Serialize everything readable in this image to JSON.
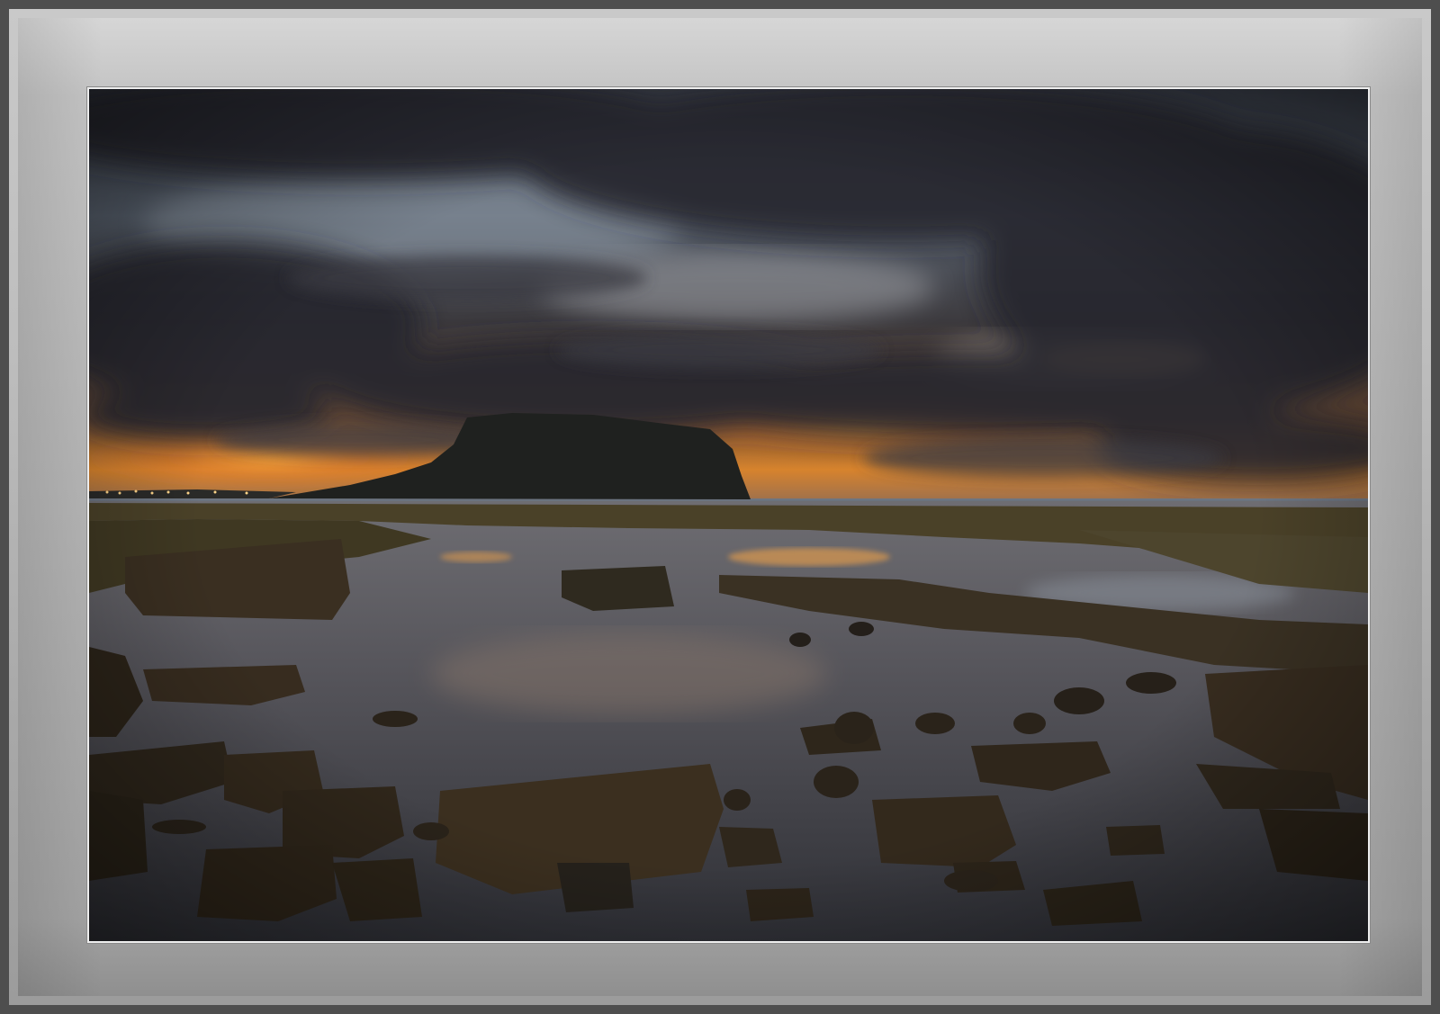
{
  "image": {
    "subject": "",
    "colors": {
      "frame_outer": "#4e4e4e",
      "mat_light": "#d6d6d6",
      "mat_dark": "#8f8f8f",
      "photo_border": "#eeeeee",
      "sky_dark": "#2a2c33",
      "sky_glow": "#e58a2a",
      "water": "#5a5a62",
      "rocks": "#2e261c"
    }
  }
}
